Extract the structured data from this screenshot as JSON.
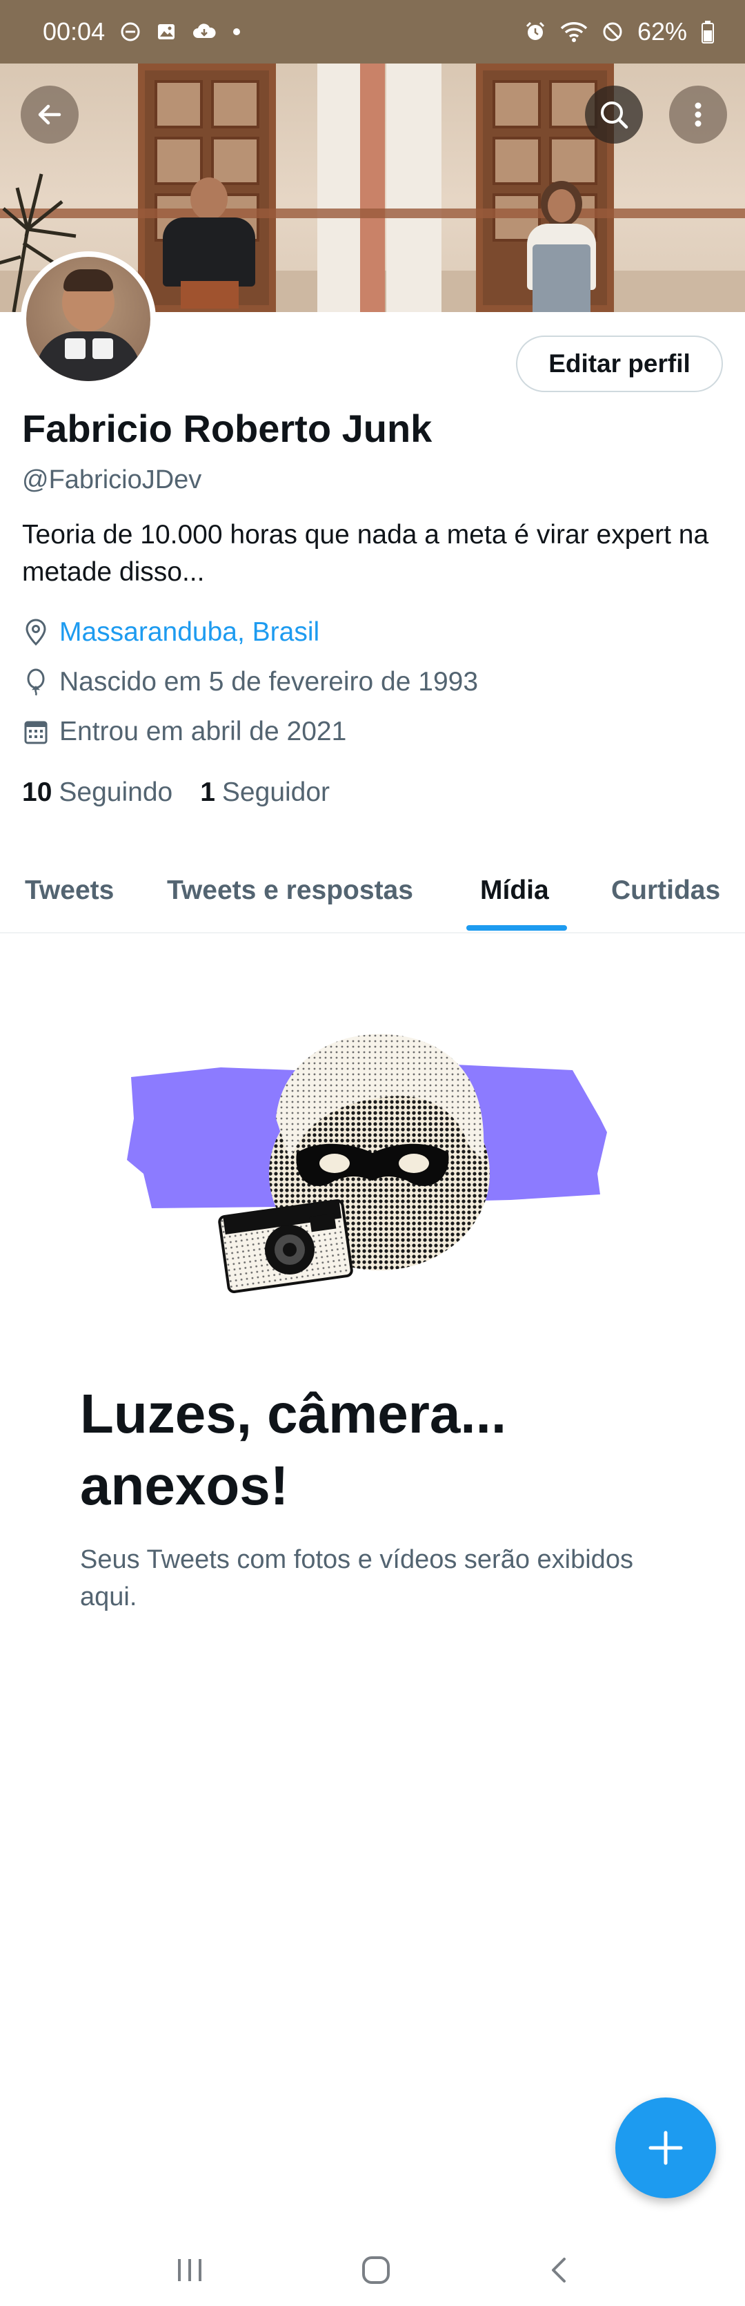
{
  "status_bar": {
    "time": "00:04",
    "battery": "62%"
  },
  "banner": {
    "back_icon": "arrow-left-icon",
    "search_icon": "search-icon",
    "more_icon": "more-vertical-icon"
  },
  "profile": {
    "name": "Fabricio Roberto Junk",
    "handle": "@FabricioJDev",
    "bio": "Teoria de 10.000 horas que nada a meta é virar expert na metade disso...",
    "location": "Massaranduba, Brasil",
    "birth": "Nascido em 5 de fevereiro de 1993",
    "joined": "Entrou em abril de 2021",
    "following_count": "10",
    "following_label": "Seguindo",
    "followers_count": "1",
    "followers_label": "Seguidor",
    "edit_label": "Editar perfil"
  },
  "tabs": [
    {
      "label": "Tweets",
      "active": false
    },
    {
      "label": "Tweets e respostas",
      "active": false
    },
    {
      "label": "Mídia",
      "active": true
    },
    {
      "label": "Curtidas",
      "active": false
    }
  ],
  "empty_state": {
    "title": "Luzes, câmera... anexos!",
    "subtitle": "Seus Tweets com fotos e vídeos serão exibidos aqui."
  },
  "fab": {
    "icon": "plus-icon"
  },
  "colors": {
    "accent": "#1d9bf0",
    "status_bar": "#836e55",
    "text_primary": "#0f1419",
    "text_secondary": "#536471",
    "illustration_purple": "#8c7bff"
  }
}
